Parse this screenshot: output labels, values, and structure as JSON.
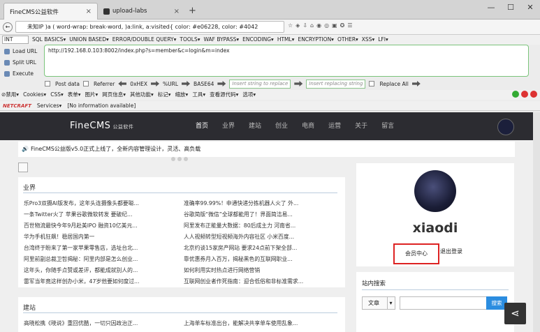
{
  "tabs": [
    {
      "title": "FineCMS公益软件",
      "close": "×"
    },
    {
      "title": "upload-labs",
      "close": "×"
    }
  ],
  "newtab": "+",
  "window": {
    "min": "—",
    "max": "☐",
    "close": "✕"
  },
  "url_text": "未知IP  )a ( word-wrap: break-word, )a:link, a:visited{ color: #e06228, color: #4042",
  "hackbar": {
    "select": "INT",
    "menu": [
      "SQL BASICS▾",
      "UNION BASED▾",
      "ERROR/DOUBLE QUERY▾",
      "TOOLS▾",
      "WAF BYPASS▾",
      "ENCODING▾",
      "HTML▾",
      "ENCRYPTION▾",
      "OTHER▾",
      "XSS▾",
      "LFI▾"
    ],
    "load": "Load URL",
    "split": "Split URL",
    "execute": "Execute",
    "input": "http://192.168.0.103:8002/index.php?s=member&c=login&m=index",
    "post": "Post data",
    "referrer": "Referrer",
    "hex": "0xHEX",
    "urlenc": "%URL",
    "base64": "BASE64",
    "find": "Insert string to replace",
    "replace": "Insert replacing string",
    "replace_all": "Replace All"
  },
  "webdev": [
    "⊘禁用▾",
    "Cookies▾",
    "CSS▾",
    "表单▾",
    "图片▾",
    "网页信息▾",
    "其他功能▾",
    "标记▾",
    "缩放▾",
    "工具▾",
    "查看源代码▾",
    "选项▾"
  ],
  "netcraft": {
    "logo": "NETCRAFT",
    "services": "Services▾",
    "info": "[No information available]"
  },
  "site": {
    "logo": "FineCMS",
    "logo_sub": "公益软件",
    "menu": [
      "首页",
      "业界",
      "建站",
      "创业",
      "电商",
      "运营",
      "关于",
      "留言"
    ],
    "notice": "FineCMS公益版v5.0正式上线了，全新内容管理设计，灵活、高负载",
    "section1": {
      "title": "业界",
      "items": [
        "乐Pro3双摄AI版发布，这年头连摄像头都要聪...",
        "准确率99.99%！申通快递分拣机器人火了 外...",
        "一条Twitter火了 苹果谷歌微软转发 要破纪...",
        "谷歌简版“微信”全球都能用了！界面简洁易...",
        "百世物流最快今年9月赴美IPO 融资10亿美元...",
        "阿里发布正能量大数据：80后成主力 河南省...",
        "华为手机狂飙！稳居国内第一",
        "人人视频转型短视频海外内容社区 小米百度...",
        "台湾终于盼来了第一家苹果零售店，选址台北...",
        "北京约谈15家房产网站 要求24点前下架全部...",
        "阿里前副总裁卫哲揭秘：阿里内部是怎么创业...",
        "靠优惠券月入百万，揭秘黑色的互联网职业...",
        "这年头，你随手点赞或差评，都能成就别人的...",
        "如何利用实时热点进行网络营销",
        "雷军当年竟这样创办小米，47岁他要如何度过...",
        "互联网创业者作死指南：迎合低俗和非标准需求..."
      ]
    },
    "section2": {
      "title": "建站",
      "items": [
        "高晓松携《晓说》重回优酷，一切只因政治正...",
        "上海单车标准出台，能解决共享单车使用乱象..."
      ]
    },
    "user": {
      "name": "xiaodi",
      "center": "会员中心",
      "logout": "退出登录"
    },
    "search": {
      "title": "站内搜索",
      "select": "文章",
      "button": "搜索"
    }
  }
}
